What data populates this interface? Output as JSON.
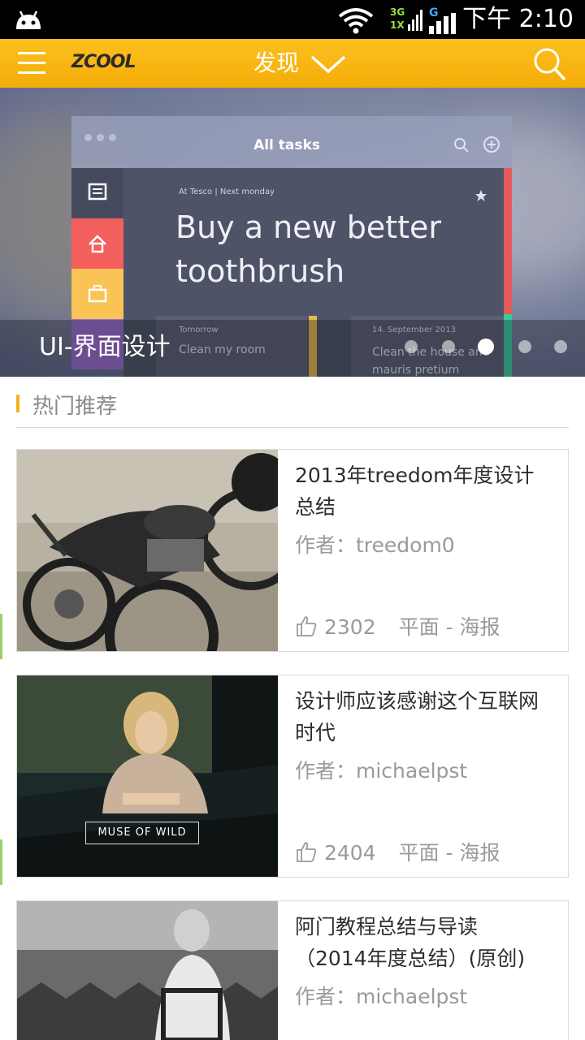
{
  "status_bar": {
    "network_1": "3G",
    "network_1_sub": "1X",
    "network_2": "G",
    "time": "下午 2:10"
  },
  "app_bar": {
    "logo": "ZCOOL",
    "title": "发现",
    "icons": [
      "menu-icon",
      "chevron-down-icon",
      "search-icon"
    ],
    "accent_color": "#f8b512"
  },
  "banner": {
    "caption": "UI-界面设计",
    "mock": {
      "window_title": "All tasks",
      "meta": "At Tesco | Next monday",
      "task_title": "Buy a new better toothbrush",
      "row1_date": "Tomorrow",
      "row1_text": "Clean my room",
      "row2_date": "14. September 2013",
      "row2_text": "Clean the house and mauris pretium"
    },
    "pager": {
      "count": 5,
      "active_index": 2
    }
  },
  "section": {
    "title": "热门推荐"
  },
  "cards": [
    {
      "title": "2013年treedom年度设计总结",
      "author": "作者：treedom0",
      "likes": "2302",
      "category": "平面 - 海报",
      "image": "motorcycle-photo"
    },
    {
      "title": "设计师应该感谢这个互联网时代",
      "author": "作者：michaelpst",
      "likes": "2404",
      "category": "平面 - 海报",
      "image": "muse-of-wild-photo",
      "image_text": "MUSE OF WILD"
    },
    {
      "title": "阿门教程总结与导读（2014年度总结）(原创)",
      "author": "作者：michaelpst",
      "image": "woman-chair-photo"
    }
  ]
}
